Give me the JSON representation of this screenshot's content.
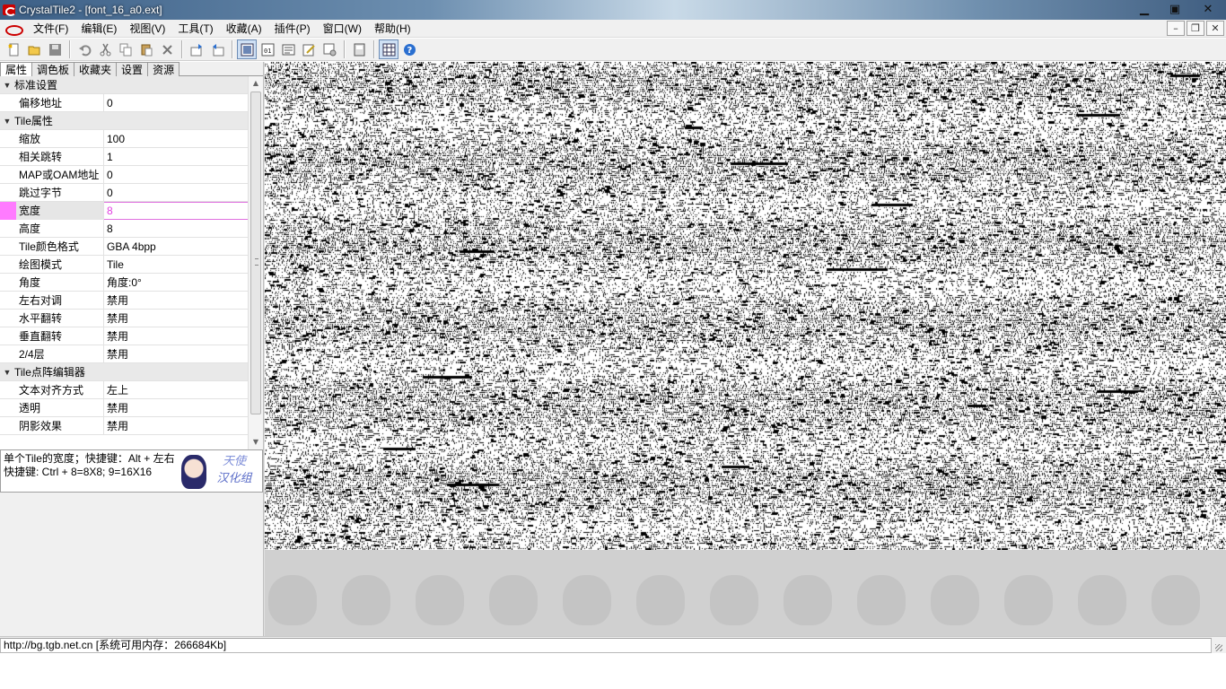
{
  "window": {
    "title": "CrystalTile2 - [font_16_a0.ext]",
    "minimize": "▁",
    "maximize": "▣",
    "close": "✕"
  },
  "menu": {
    "items": [
      "文件(F)",
      "编辑(E)",
      "视图(V)",
      "工具(T)",
      "收藏(A)",
      "插件(P)",
      "窗口(W)",
      "帮助(H)"
    ],
    "mdi_minimize": "–",
    "mdi_restore": "❐",
    "mdi_close": "✕"
  },
  "toolbar": {
    "icons": [
      "new-file-icon",
      "open-folder-icon",
      "save-icon",
      "undo-icon",
      "cut-icon",
      "copy-icon",
      "paste-icon",
      "delete-icon",
      "import-icon",
      "export-icon",
      "tile-view-icon",
      "hex-view-icon",
      "text-view-icon",
      "edit-icon",
      "palette-icon",
      "print-icon",
      "grid-icon",
      "help-icon"
    ],
    "active": [
      "tile-view-icon",
      "grid-icon"
    ]
  },
  "tabs": [
    "属性",
    "调色板",
    "收藏夹",
    "设置",
    "资源"
  ],
  "properties": {
    "categories": [
      {
        "label": "标准设置",
        "rows": [
          {
            "name": "偏移地址",
            "value": "0"
          }
        ]
      },
      {
        "label": "Tile属性",
        "rows": [
          {
            "name": "缩放",
            "value": "100"
          },
          {
            "name": "相关跳转",
            "value": "1"
          },
          {
            "name": "MAP或OAM地址",
            "value": "0"
          },
          {
            "name": "跳过字节",
            "value": "0"
          },
          {
            "name": "宽度",
            "value": "8",
            "selected": true
          },
          {
            "name": "高度",
            "value": "8"
          },
          {
            "name": "Tile颜色格式",
            "value": "GBA  4bpp"
          },
          {
            "name": "绘图模式",
            "value": "Tile"
          },
          {
            "name": "角度",
            "value": "角度:0°"
          },
          {
            "name": "左右对调",
            "value": "禁用"
          },
          {
            "name": "水平翻转",
            "value": "禁用"
          },
          {
            "name": "垂直翻转",
            "value": "禁用"
          },
          {
            "name": "2/4层",
            "value": "禁用"
          }
        ]
      },
      {
        "label": "Tile点阵编辑器",
        "rows": [
          {
            "name": "文本对齐方式",
            "value": "左上"
          },
          {
            "name": "透明",
            "value": "禁用"
          },
          {
            "name": "阴影效果",
            "value": "禁用"
          }
        ]
      }
    ]
  },
  "help": {
    "line1": "单个Tile的宽度；快捷键：Alt + 左右",
    "line2": "快捷键: Ctrl + 8=8X8; 9=16X16",
    "logo_line1": "天使",
    "logo_line2": "汉化组"
  },
  "status": {
    "text": "http://bg.tgb.net.cn [系统可用内存：266684Kb]"
  },
  "colors": {
    "selected_accent": "#ff7bff",
    "tile_pixels": "#000000",
    "tile_background": "#ffffff"
  }
}
